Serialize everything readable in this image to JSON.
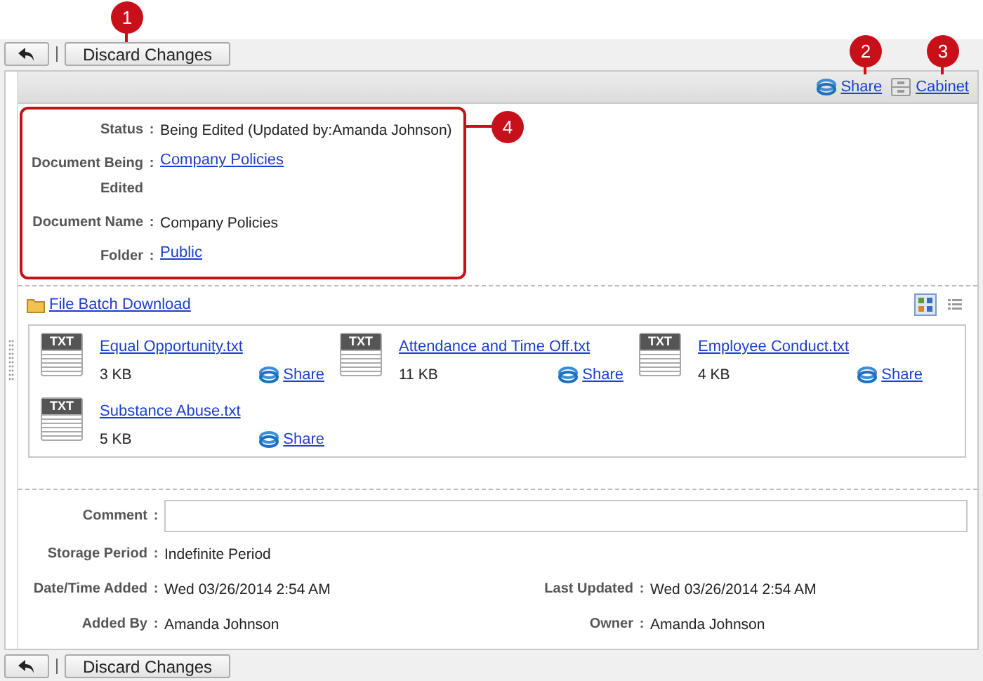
{
  "top_toolbar": {
    "buttons": [
      {
        "kind": "back"
      },
      {
        "kind": "text",
        "label": "Discard Changes"
      }
    ]
  },
  "header_links": [
    {
      "kind": "share",
      "label": "Share"
    },
    {
      "kind": "cabinet",
      "label": "Cabinet"
    }
  ],
  "info_fields": [
    {
      "label": "Status",
      "colon": ":",
      "kind": "text",
      "value": "Being Edited (Updated by:Amanda Johnson)"
    },
    {
      "label": "Document Being Edited",
      "colon": ":",
      "kind": "link",
      "value": "Company Policies"
    },
    {
      "label": "Document Name",
      "colon": ":",
      "kind": "text",
      "value": "Company Policies"
    },
    {
      "label": "Folder",
      "colon": ":",
      "kind": "link",
      "value": "Public"
    }
  ],
  "batch_download": {
    "label": "File Batch Download"
  },
  "view_modes": [
    {
      "kind": "thumbnails",
      "selected": true
    },
    {
      "kind": "list",
      "selected": false
    }
  ],
  "files": [
    {
      "type": "TXT",
      "name": "Equal Opportunity.txt",
      "size": "3 KB",
      "share": "Share"
    },
    {
      "type": "TXT",
      "name": "Attendance and Time Off.txt",
      "size": "11 KB",
      "share": "Share"
    },
    {
      "type": "TXT",
      "name": "Employee Conduct.txt",
      "size": "4 KB",
      "share": "Share"
    },
    {
      "type": "TXT",
      "name": "Substance Abuse.txt",
      "size": "5 KB",
      "share": "Share"
    }
  ],
  "comment": {
    "label": "Comment",
    "colon": ":"
  },
  "storage": {
    "label": "Storage Period",
    "colon": ":",
    "value": "Indefinite Period"
  },
  "details": [
    {
      "label": "Date/Time Added",
      "colon": ":",
      "value": "Wed 03/26/2014 2:54 AM"
    },
    {
      "label": "Last Updated",
      "colon": ":",
      "value": "Wed 03/26/2014 2:54 AM"
    },
    {
      "label": "Added By",
      "colon": ":",
      "value": "Amanda Johnson"
    },
    {
      "label": "Owner",
      "colon": ":",
      "value": "Amanda Johnson"
    }
  ],
  "bottom_toolbar": {
    "buttons": [
      {
        "kind": "back"
      },
      {
        "kind": "text",
        "label": "Discard Changes"
      }
    ]
  },
  "callouts": [
    "1",
    "2",
    "3",
    "4"
  ]
}
